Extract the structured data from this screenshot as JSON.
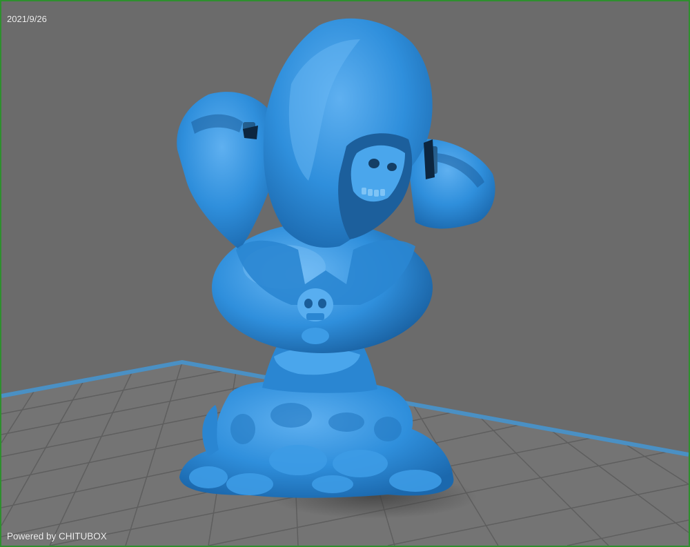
{
  "viewport": {
    "date": "2021/9/26",
    "watermark": "Powered by CHITUBOX"
  },
  "colors": {
    "background": "#6b6b6b",
    "build_plate": "#747474",
    "grid_lines": "#5b5b5b",
    "plate_border": "#4a90c4",
    "model": "#2f8fdc",
    "frame": "#2e8f2e"
  },
  "scene": {
    "object": "3d-model",
    "surface": "build-plate"
  }
}
